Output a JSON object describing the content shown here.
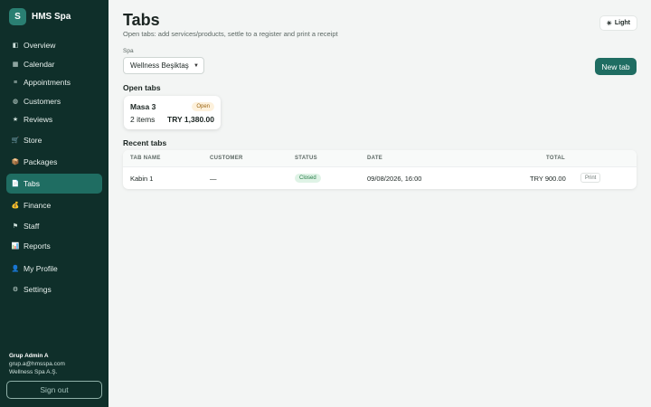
{
  "sidebar": {
    "brand_initial": "S",
    "brand_name": "HMS Spa",
    "items": [
      {
        "label": "Overview",
        "icon": "◧"
      },
      {
        "label": "Calendar",
        "icon": "▦"
      },
      {
        "label": "Appointments",
        "icon": "≡"
      },
      {
        "label": "Customers",
        "icon": "◍"
      },
      {
        "label": "Reviews",
        "icon": "★"
      },
      {
        "label": "Store",
        "icon": "🛒"
      },
      {
        "label": "Packages",
        "icon": "📦"
      },
      {
        "label": "Tabs",
        "icon": "📄"
      },
      {
        "label": "Finance",
        "icon": "💰"
      },
      {
        "label": "Staff",
        "icon": "⚑"
      },
      {
        "label": "Reports",
        "icon": "📊"
      },
      {
        "label": "My Profile",
        "icon": "👤"
      },
      {
        "label": "Settings",
        "icon": "⚙"
      }
    ],
    "active_item": "Tabs",
    "user": {
      "name": "Grup Admin A",
      "email": "grup.a@hmsspa.com",
      "company": "Wellness Spa A.Ş."
    },
    "signout_label": "Sign out"
  },
  "header": {
    "title": "Tabs",
    "subtitle": "Open tabs: add services/products, settle to a register and print a receipt",
    "theme_icon": "☀",
    "theme_label": "Light"
  },
  "filters": {
    "spa_label": "Spa",
    "spa_value": "Wellness Beşiktaş",
    "new_tab_label": "New tab"
  },
  "open_tabs": {
    "title": "Open tabs",
    "cards": [
      {
        "name": "Masa 3",
        "status": "Open",
        "items": "2 items",
        "total": "TRY 1,380.00"
      }
    ]
  },
  "recent_tabs": {
    "title": "Recent tabs",
    "columns": [
      "TAB NAME",
      "CUSTOMER",
      "STATUS",
      "DATE",
      "TOTAL"
    ],
    "rows": [
      {
        "tab_name": "Kabin 1",
        "customer": "—",
        "status": "Closed",
        "date": "09/08/2026, 16:00",
        "total": "TRY 900.00",
        "action": "Print"
      }
    ]
  },
  "colors": {
    "sidebar_bg": "#0f2f2a",
    "accent": "#1f6d62",
    "open_badge": "#fdf1dc",
    "closed_badge": "#dff3e6"
  }
}
